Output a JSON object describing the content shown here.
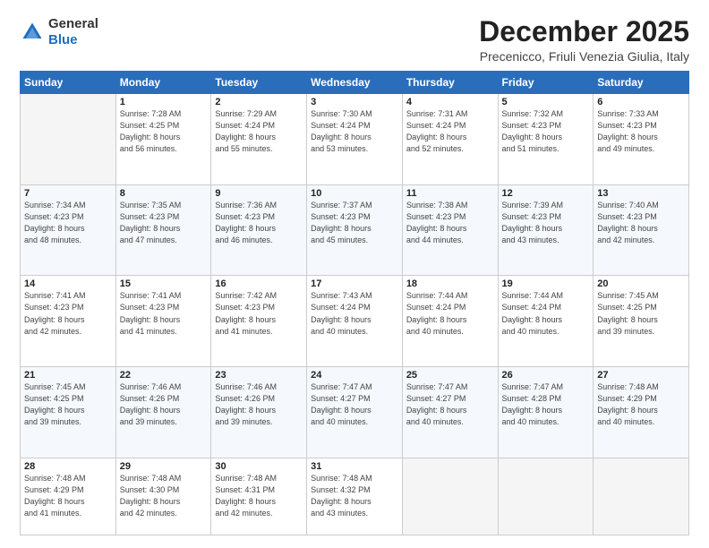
{
  "header": {
    "logo_line1": "General",
    "logo_line2": "Blue",
    "month": "December 2025",
    "location": "Precenicco, Friuli Venezia Giulia, Italy"
  },
  "days_of_week": [
    "Sunday",
    "Monday",
    "Tuesday",
    "Wednesday",
    "Thursday",
    "Friday",
    "Saturday"
  ],
  "weeks": [
    [
      {
        "day": null,
        "info": ""
      },
      {
        "day": "1",
        "info": "Sunrise: 7:28 AM\nSunset: 4:25 PM\nDaylight: 8 hours\nand 56 minutes."
      },
      {
        "day": "2",
        "info": "Sunrise: 7:29 AM\nSunset: 4:24 PM\nDaylight: 8 hours\nand 55 minutes."
      },
      {
        "day": "3",
        "info": "Sunrise: 7:30 AM\nSunset: 4:24 PM\nDaylight: 8 hours\nand 53 minutes."
      },
      {
        "day": "4",
        "info": "Sunrise: 7:31 AM\nSunset: 4:24 PM\nDaylight: 8 hours\nand 52 minutes."
      },
      {
        "day": "5",
        "info": "Sunrise: 7:32 AM\nSunset: 4:23 PM\nDaylight: 8 hours\nand 51 minutes."
      },
      {
        "day": "6",
        "info": "Sunrise: 7:33 AM\nSunset: 4:23 PM\nDaylight: 8 hours\nand 49 minutes."
      }
    ],
    [
      {
        "day": "7",
        "info": "Sunrise: 7:34 AM\nSunset: 4:23 PM\nDaylight: 8 hours\nand 48 minutes."
      },
      {
        "day": "8",
        "info": "Sunrise: 7:35 AM\nSunset: 4:23 PM\nDaylight: 8 hours\nand 47 minutes."
      },
      {
        "day": "9",
        "info": "Sunrise: 7:36 AM\nSunset: 4:23 PM\nDaylight: 8 hours\nand 46 minutes."
      },
      {
        "day": "10",
        "info": "Sunrise: 7:37 AM\nSunset: 4:23 PM\nDaylight: 8 hours\nand 45 minutes."
      },
      {
        "day": "11",
        "info": "Sunrise: 7:38 AM\nSunset: 4:23 PM\nDaylight: 8 hours\nand 44 minutes."
      },
      {
        "day": "12",
        "info": "Sunrise: 7:39 AM\nSunset: 4:23 PM\nDaylight: 8 hours\nand 43 minutes."
      },
      {
        "day": "13",
        "info": "Sunrise: 7:40 AM\nSunset: 4:23 PM\nDaylight: 8 hours\nand 42 minutes."
      }
    ],
    [
      {
        "day": "14",
        "info": "Sunrise: 7:41 AM\nSunset: 4:23 PM\nDaylight: 8 hours\nand 42 minutes."
      },
      {
        "day": "15",
        "info": "Sunrise: 7:41 AM\nSunset: 4:23 PM\nDaylight: 8 hours\nand 41 minutes."
      },
      {
        "day": "16",
        "info": "Sunrise: 7:42 AM\nSunset: 4:23 PM\nDaylight: 8 hours\nand 41 minutes."
      },
      {
        "day": "17",
        "info": "Sunrise: 7:43 AM\nSunset: 4:24 PM\nDaylight: 8 hours\nand 40 minutes."
      },
      {
        "day": "18",
        "info": "Sunrise: 7:44 AM\nSunset: 4:24 PM\nDaylight: 8 hours\nand 40 minutes."
      },
      {
        "day": "19",
        "info": "Sunrise: 7:44 AM\nSunset: 4:24 PM\nDaylight: 8 hours\nand 40 minutes."
      },
      {
        "day": "20",
        "info": "Sunrise: 7:45 AM\nSunset: 4:25 PM\nDaylight: 8 hours\nand 39 minutes."
      }
    ],
    [
      {
        "day": "21",
        "info": "Sunrise: 7:45 AM\nSunset: 4:25 PM\nDaylight: 8 hours\nand 39 minutes."
      },
      {
        "day": "22",
        "info": "Sunrise: 7:46 AM\nSunset: 4:26 PM\nDaylight: 8 hours\nand 39 minutes."
      },
      {
        "day": "23",
        "info": "Sunrise: 7:46 AM\nSunset: 4:26 PM\nDaylight: 8 hours\nand 39 minutes."
      },
      {
        "day": "24",
        "info": "Sunrise: 7:47 AM\nSunset: 4:27 PM\nDaylight: 8 hours\nand 40 minutes."
      },
      {
        "day": "25",
        "info": "Sunrise: 7:47 AM\nSunset: 4:27 PM\nDaylight: 8 hours\nand 40 minutes."
      },
      {
        "day": "26",
        "info": "Sunrise: 7:47 AM\nSunset: 4:28 PM\nDaylight: 8 hours\nand 40 minutes."
      },
      {
        "day": "27",
        "info": "Sunrise: 7:48 AM\nSunset: 4:29 PM\nDaylight: 8 hours\nand 40 minutes."
      }
    ],
    [
      {
        "day": "28",
        "info": "Sunrise: 7:48 AM\nSunset: 4:29 PM\nDaylight: 8 hours\nand 41 minutes."
      },
      {
        "day": "29",
        "info": "Sunrise: 7:48 AM\nSunset: 4:30 PM\nDaylight: 8 hours\nand 42 minutes."
      },
      {
        "day": "30",
        "info": "Sunrise: 7:48 AM\nSunset: 4:31 PM\nDaylight: 8 hours\nand 42 minutes."
      },
      {
        "day": "31",
        "info": "Sunrise: 7:48 AM\nSunset: 4:32 PM\nDaylight: 8 hours\nand 43 minutes."
      },
      {
        "day": null,
        "info": ""
      },
      {
        "day": null,
        "info": ""
      },
      {
        "day": null,
        "info": ""
      }
    ]
  ]
}
